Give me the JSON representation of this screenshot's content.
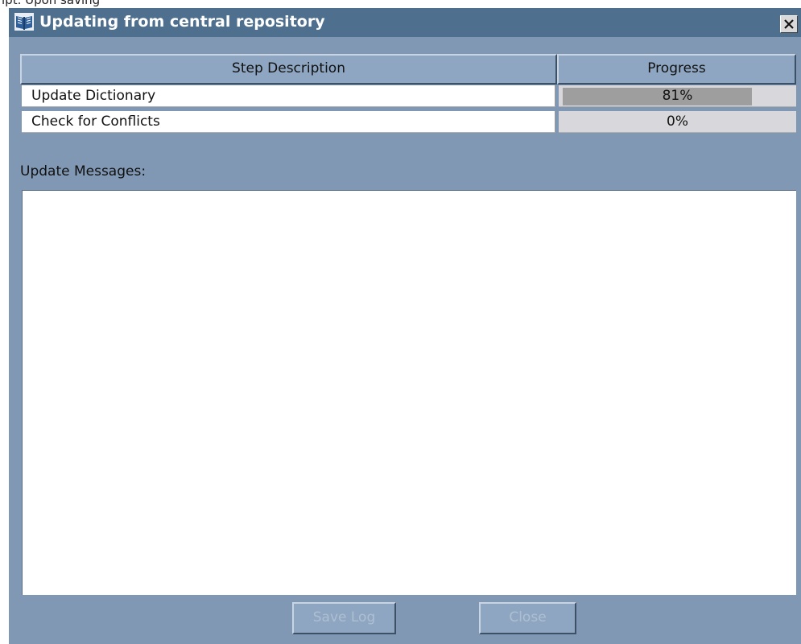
{
  "top_strip": {
    "text": "ipt. Upon saving"
  },
  "window": {
    "title": "Updating from central repository",
    "icon": "open-book-icon",
    "close_icon": "close-icon"
  },
  "table": {
    "columns": [
      "Step Description",
      "Progress"
    ],
    "rows": [
      {
        "step": "Update Dictionary",
        "progress_label": "81%",
        "progress_fraction": 0.81
      },
      {
        "step": "Check for Conflicts",
        "progress_label": "0%",
        "progress_fraction": 0.0
      }
    ]
  },
  "messages": {
    "label": "Update Messages:",
    "content": ""
  },
  "buttons": {
    "save_log": "Save Log",
    "close": "Close",
    "enabled": false
  },
  "colors": {
    "dialog_background": "#8098b4",
    "titlebar": "#4f6f8e",
    "progress_fill": "#9e9e9e",
    "progress_track": "#d8d8dc",
    "disabled_text": "#aebfd2"
  }
}
